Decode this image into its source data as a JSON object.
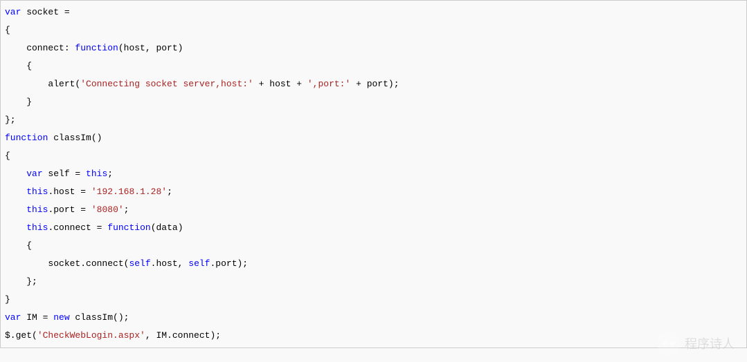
{
  "code": {
    "l1a": "var",
    "l1b": " socket =",
    "l2": "{",
    "l3a": "    connect: ",
    "l3b": "function",
    "l3c": "(host, port)",
    "l4": "    {",
    "l5a": "        alert(",
    "l5b": "'Connecting socket server,host:'",
    "l5c": " + host + ",
    "l5d": "',port:'",
    "l5e": " + port);",
    "l6": "    }",
    "l7": "};",
    "l8a": "function",
    "l8b": " classIm()",
    "l9": "{",
    "l10a": "    ",
    "l10b": "var",
    "l10c": " self = ",
    "l10d": "this",
    "l10e": ";",
    "l11a": "    ",
    "l11b": "this",
    "l11c": ".host = ",
    "l11d": "'192.168.1.28'",
    "l11e": ";",
    "l12a": "    ",
    "l12b": "this",
    "l12c": ".port = ",
    "l12d": "'8080'",
    "l12e": ";",
    "l13a": "    ",
    "l13b": "this",
    "l13c": ".connect = ",
    "l13d": "function",
    "l13e": "(data)",
    "l14": "    {",
    "l15a": "        socket.connect(",
    "l15b": "self",
    "l15c": ".host, ",
    "l15d": "self",
    "l15e": ".port);",
    "l16": "    };",
    "l17": "}",
    "l18a": "var",
    "l18b": " IM = ",
    "l18c": "new",
    "l18d": " classIm();",
    "l19a": "$.get(",
    "l19b": "'CheckWebLogin.aspx'",
    "l19c": ", IM.connect);"
  },
  "watermark": "程序诗人"
}
